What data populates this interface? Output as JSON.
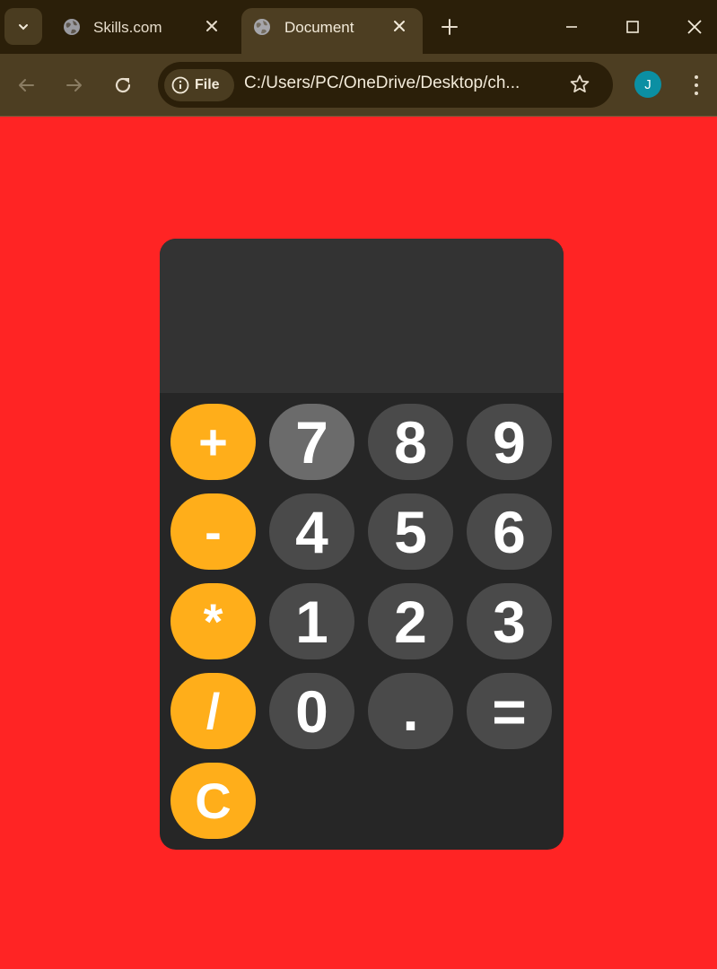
{
  "browser": {
    "tabs": [
      {
        "title": "Skills.com",
        "active": false
      },
      {
        "title": "Document",
        "active": true
      }
    ],
    "address": {
      "chip_label": "File",
      "url": "C:/Users/PC/OneDrive/Desktop/ch..."
    },
    "profile_initial": "J",
    "colors": {
      "frame": "#2b1f09",
      "toolbar": "#4d3e22",
      "avatar": "#0b8fa3"
    }
  },
  "page": {
    "background": "#ff2424"
  },
  "calculator": {
    "display": "",
    "operators": [
      "+",
      "-",
      "*",
      "/",
      "C"
    ],
    "rows": [
      [
        "7",
        "8",
        "9"
      ],
      [
        "4",
        "5",
        "6"
      ],
      [
        "1",
        "2",
        "3"
      ],
      [
        "0",
        ".",
        "="
      ]
    ],
    "colors": {
      "operator": "#ffae1a",
      "number": "#4a4a4a",
      "body": "#262626",
      "display": "#333333"
    }
  }
}
